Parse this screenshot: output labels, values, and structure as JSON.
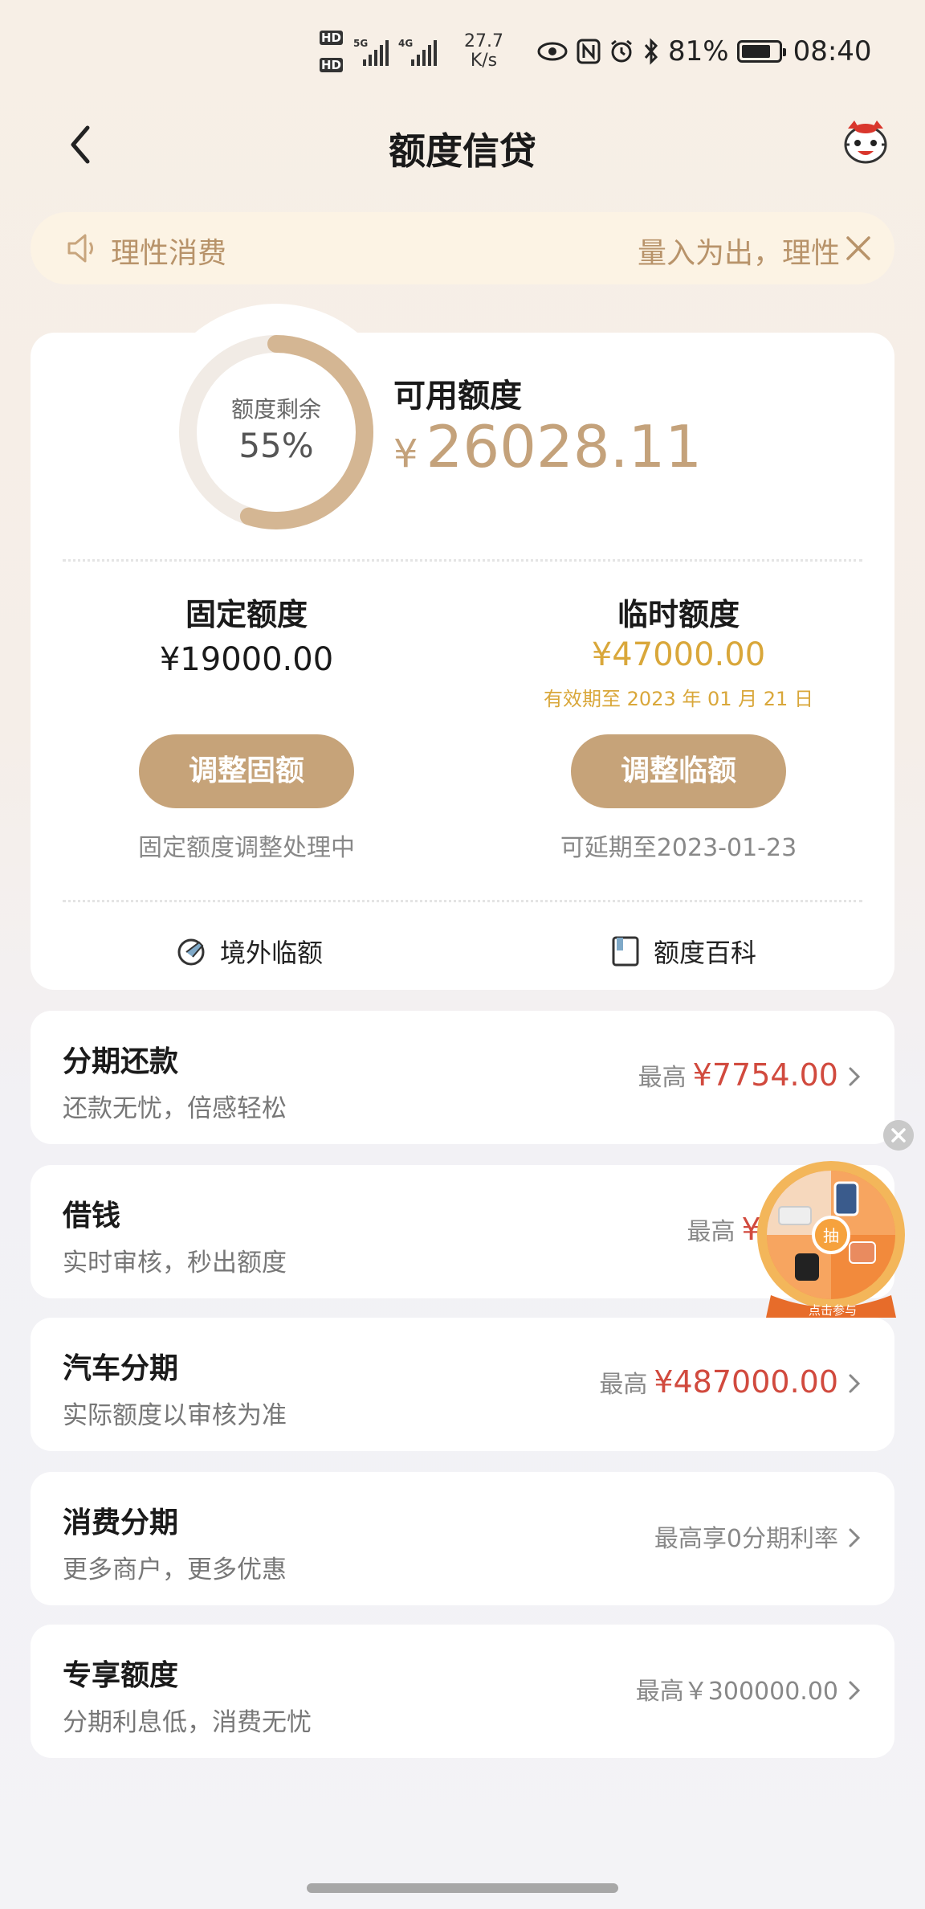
{
  "status_bar": {
    "hd1": "HD",
    "hd2": "HD",
    "net1": "5G",
    "net2": "4G",
    "speed_value": "27.7",
    "speed_unit": "K/s",
    "battery_percent": "81%",
    "battery_level": 0.81,
    "time": "08:40"
  },
  "nav": {
    "title": "额度信贷"
  },
  "notice": {
    "text_left": "理性消费",
    "text_right": "量入为出，理性"
  },
  "credit": {
    "ring_label": "额度剩余",
    "ring_value": "55%",
    "ring_fraction": 0.55,
    "available_label": "可用额度",
    "available_currency": "¥",
    "available_amount": "26028.11",
    "fixed": {
      "title": "固定额度",
      "amount": "¥19000.00",
      "button": "调整固额",
      "note": "固定额度调整处理中"
    },
    "temp": {
      "title": "临时额度",
      "amount": "¥47000.00",
      "expire": "有效期至 2023 年 01 月 21 日",
      "button": "调整临额",
      "note": "可延期至2023-01-23"
    },
    "quick_links": [
      {
        "label": "境外临额",
        "icon": "globe-plane-icon"
      },
      {
        "label": "额度百科",
        "icon": "book-icon"
      }
    ]
  },
  "list": [
    {
      "title": "分期还款",
      "subtitle": "还款无忧，倍感轻松",
      "prefix": "最高",
      "amount": "¥7754.00"
    },
    {
      "title": "借钱",
      "subtitle": "实时审核，秒出额度",
      "prefix": "最高",
      "amount": "¥19"
    },
    {
      "title": "汽车分期",
      "subtitle": "实际额度以审核为准",
      "prefix": "最高",
      "amount": "¥487000.00"
    },
    {
      "title": "消费分期",
      "subtitle": "更多商户，更多优惠",
      "plain": "最高享0分期利率"
    },
    {
      "title": "专享额度",
      "subtitle": "分期利息低，消费无忧",
      "plain": "最高￥300000.00"
    }
  ],
  "float_widget": {
    "center": "抽",
    "label": "点击参与"
  },
  "colors": {
    "gold": "#c6a379",
    "amount_red": "#d14a3e",
    "temp_gold": "#d9a73a",
    "notice_bg": "#fcf3e4"
  }
}
